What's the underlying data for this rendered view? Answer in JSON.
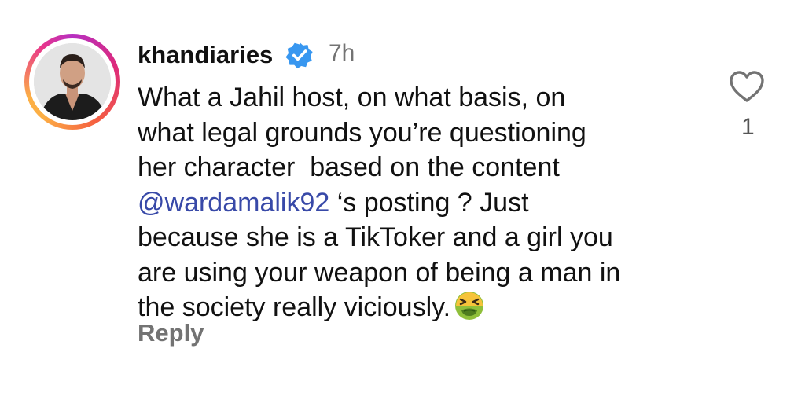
{
  "comment": {
    "username": "khandiaries",
    "verified_icon": "verified-badge-icon",
    "time": "7h",
    "text_lines": [
      "What a Jahil host, on what basis, on",
      "what legal grounds you’re questioning",
      "her character  based on the content",
      "",
      "because she is a TikToker and a girl you",
      "are using your weapon of being a man in",
      "the society really viciously."
    ],
    "mention": "@wardamalik92",
    "mention_suffix": " ‘s posting ? Just",
    "emoji": "nauseated-face-emoji",
    "reply_label": "Reply",
    "like_icon": "heart-outline-icon",
    "like_count": "1"
  },
  "colors": {
    "mention": "#3849a8",
    "muted": "#737373",
    "verified": "#3897f0"
  }
}
